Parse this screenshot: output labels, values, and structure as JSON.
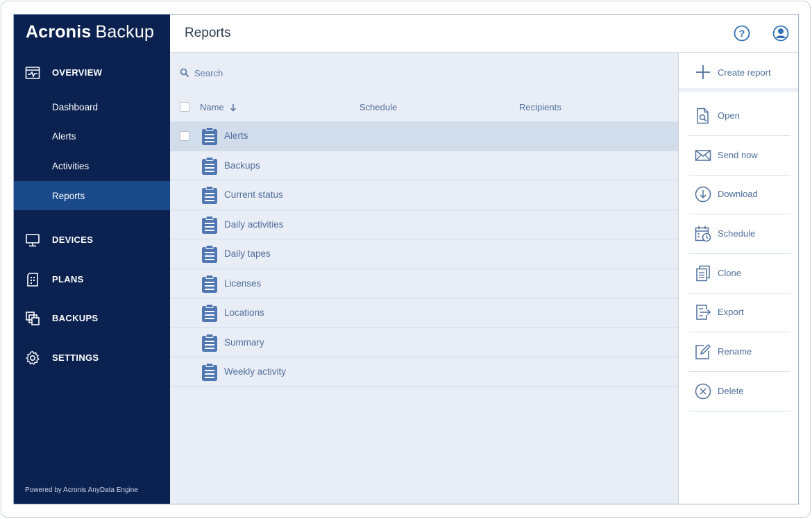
{
  "app": {
    "brand_bold": "Acronis",
    "brand_light": "Backup",
    "powered_by": "Powered by Acronis AnyData Engine"
  },
  "sidebar": {
    "sections": [
      {
        "label": "OVERVIEW",
        "icon": "overview-icon"
      },
      {
        "label": "DEVICES",
        "icon": "monitor-icon"
      },
      {
        "label": "PLANS",
        "icon": "plans-icon"
      },
      {
        "label": "BACKUPS",
        "icon": "backups-icon"
      },
      {
        "label": "SETTINGS",
        "icon": "gear-icon"
      }
    ],
    "overview_items": [
      {
        "label": "Dashboard"
      },
      {
        "label": "Alerts"
      },
      {
        "label": "Activities"
      },
      {
        "label": "Reports"
      }
    ],
    "active_item": "Reports"
  },
  "header": {
    "title": "Reports",
    "icons": [
      "help-icon",
      "user-icon"
    ]
  },
  "search": {
    "placeholder": "Search"
  },
  "table": {
    "columns": [
      "Name",
      "Schedule",
      "Recipients"
    ],
    "sort_column": "Name",
    "sort_direction": "descending",
    "rows": [
      {
        "name": "Alerts"
      },
      {
        "name": "Backups"
      },
      {
        "name": "Current status"
      },
      {
        "name": "Daily activities"
      },
      {
        "name": "Daily tapes"
      },
      {
        "name": "Licenses"
      },
      {
        "name": "Locations"
      },
      {
        "name": "Summary"
      },
      {
        "name": "Weekly activity"
      }
    ],
    "selected_row": "Alerts"
  },
  "actions": {
    "create_label": "Create report",
    "items": [
      {
        "label": "Open",
        "icon": "open-icon"
      },
      {
        "label": "Send now",
        "icon": "envelope-icon"
      },
      {
        "label": "Download",
        "icon": "download-icon"
      },
      {
        "label": "Schedule",
        "icon": "schedule-icon"
      },
      {
        "label": "Clone",
        "icon": "clone-icon"
      },
      {
        "label": "Export",
        "icon": "export-icon"
      },
      {
        "label": "Rename",
        "icon": "rename-icon"
      },
      {
        "label": "Delete",
        "icon": "delete-icon"
      }
    ]
  },
  "colors": {
    "sidebar_bg": "#0b2150",
    "sidebar_active": "#1a4a8a",
    "content_bg": "#e9edf5",
    "accent": "#4e6f9c",
    "selected_row": "#d2ddec"
  }
}
